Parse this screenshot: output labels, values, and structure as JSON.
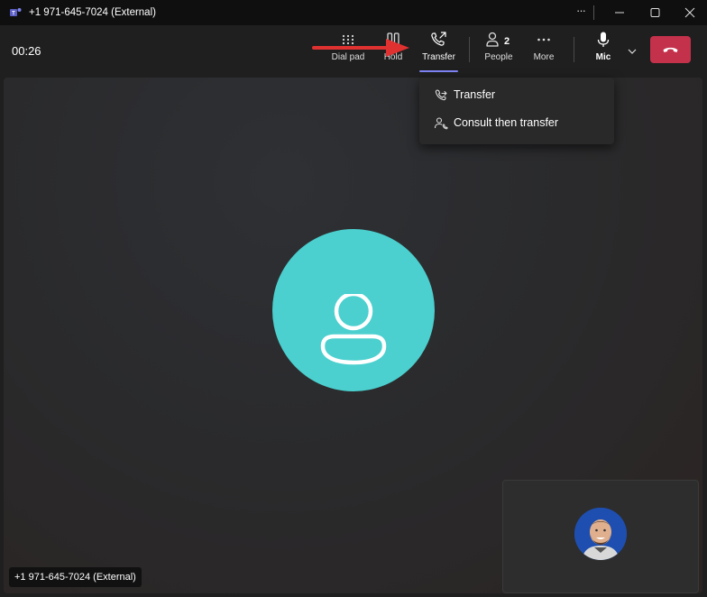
{
  "window": {
    "title": "+1 971-645-7024 (External)",
    "app_icon": "teams-logo",
    "controls": [
      "more-options-icon",
      "minimize-icon",
      "maximize-icon",
      "close-icon"
    ]
  },
  "call": {
    "timer": "00:26",
    "caller_label": "+1 971-645-7024 (External)"
  },
  "toolbar": {
    "dialpad_label": "Dial pad",
    "hold_label": "Hold",
    "transfer_label": "Transfer",
    "people_label": "People",
    "people_count": "2",
    "more_label": "More",
    "mic_label": "Mic"
  },
  "transfer_menu": {
    "items": [
      {
        "label": "Transfer",
        "icon": "call-transfer-icon"
      },
      {
        "label": "Consult then transfer",
        "icon": "people-consult-icon"
      }
    ]
  },
  "colors": {
    "hangup": "#c4314b",
    "avatar": "#4bd0cf",
    "accent": "#7f85f5",
    "annotation_arrow": "#e03131"
  }
}
